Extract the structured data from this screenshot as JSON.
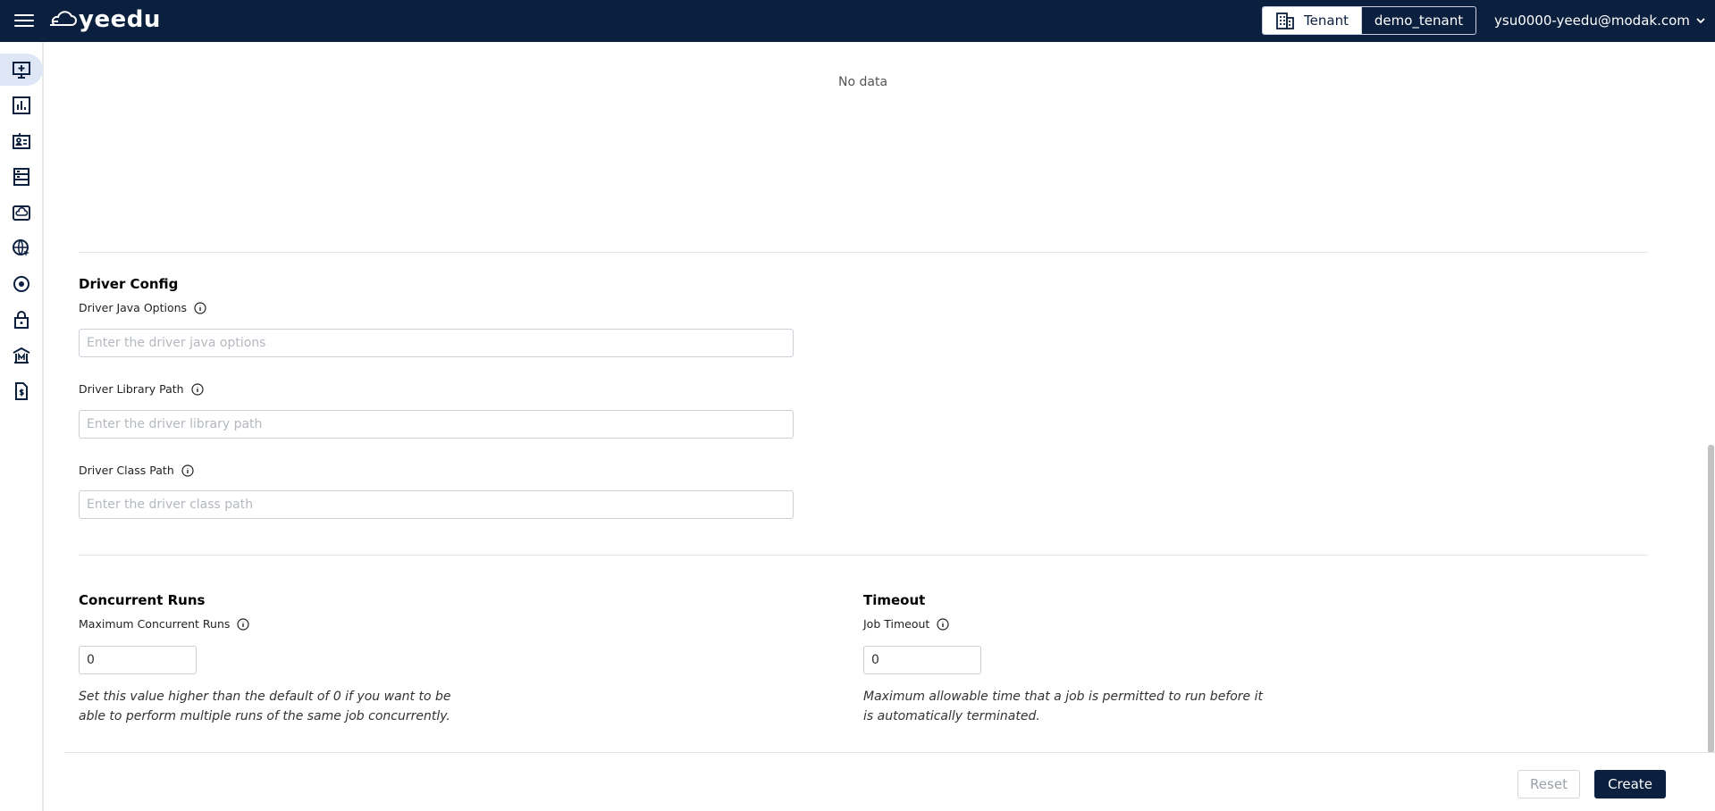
{
  "header": {
    "logo_text": "yeedu",
    "tenant_label": "Tenant",
    "tenant_value": "demo_tenant",
    "user_email": "ysu0000-yeedu@modak.com",
    "bg_color": "#0b1f3f"
  },
  "sidebar": {
    "items": [
      {
        "icon": "add-to-screen-icon",
        "active": true
      },
      {
        "icon": "bar-chart-icon",
        "active": false
      },
      {
        "icon": "id-card-icon",
        "active": false
      },
      {
        "icon": "rack-icon",
        "active": false
      },
      {
        "icon": "cloud-drive-icon",
        "active": false
      },
      {
        "icon": "globe-cursor-icon",
        "active": false
      },
      {
        "icon": "target-icon",
        "active": false
      },
      {
        "icon": "lock-icon",
        "active": false
      },
      {
        "icon": "bank-icon",
        "active": false
      },
      {
        "icon": "billing-icon",
        "active": false
      }
    ]
  },
  "main": {
    "no_data_text": "No data",
    "driver_config": {
      "title": "Driver Config",
      "java_options": {
        "label": "Driver Java Options",
        "placeholder": "Enter the driver java options",
        "value": ""
      },
      "library_path": {
        "label": "Driver Library Path",
        "placeholder": "Enter the driver library path",
        "value": ""
      },
      "class_path": {
        "label": "Driver Class Path",
        "placeholder": "Enter the driver class path",
        "value": ""
      }
    },
    "concurrent_runs": {
      "title": "Concurrent Runs",
      "label": "Maximum Concurrent Runs",
      "value": "0",
      "help_line1": "Set this value higher than the default of 0 if you want to be",
      "help_line2": "able to perform multiple runs of the same job concurrently."
    },
    "timeout": {
      "title": "Timeout",
      "label": "Job Timeout",
      "value": "0",
      "help_line1": "Maximum allowable time that a job is permitted to run before it",
      "help_line2": "is automatically terminated."
    }
  },
  "footer": {
    "reset_label": "Reset",
    "create_label": "Create"
  }
}
